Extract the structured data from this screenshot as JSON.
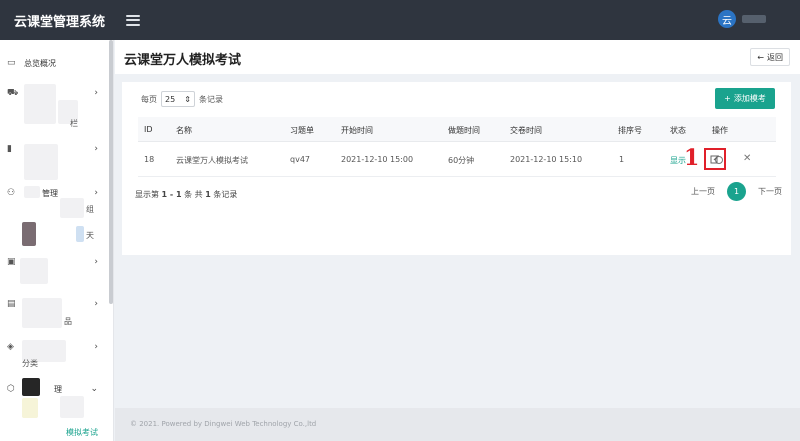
{
  "header": {
    "brand": "云课堂管理系统",
    "avatar_char": "云"
  },
  "sidebar": {
    "items": [
      {
        "label": "总览概况",
        "has_chevron": false
      },
      {
        "label": "",
        "has_chevron": true
      },
      {
        "label": "",
        "has_chevron": true
      },
      {
        "label": "管理",
        "has_chevron": true
      },
      {
        "label": "",
        "has_chevron": true
      },
      {
        "label": "",
        "has_chevron": true
      },
      {
        "label": "",
        "has_chevron": true
      },
      {
        "label": "理",
        "has_chevron": true
      }
    ],
    "sub_labels": {
      "a": "栏",
      "b": "组",
      "c": "天",
      "d": "品",
      "e": "分类"
    },
    "active_sub": "模拟考试",
    "chevron_right": "›",
    "chevron_down": "⌄"
  },
  "page": {
    "title": "云课堂万人模拟考试",
    "back_label": "返回"
  },
  "toolbar": {
    "perpage_prefix": "每页",
    "perpage_value": "25",
    "perpage_suffix": "条记录",
    "add_label": "添加模考"
  },
  "table": {
    "columns": [
      "ID",
      "名称",
      "习题单",
      "开始时间",
      "做题时间",
      "交卷时间",
      "排序号",
      "状态",
      "操作"
    ],
    "rows": [
      {
        "id": "18",
        "name": "云课堂万人模拟考试",
        "sheet": "qv47",
        "start": "2021-12-10 15:00",
        "duration": "60分钟",
        "submit": "2021-12-10 15:10",
        "order": "1",
        "status": "显示"
      }
    ]
  },
  "annotation": "1",
  "summary": {
    "prefix": "显示第",
    "range": "1 - 1",
    "mid": "条  共",
    "total": "1",
    "suffix": "条记录"
  },
  "pager": {
    "prev": "上一页",
    "current": "1",
    "next": "下一页"
  },
  "footer": {
    "text": "© 2021. Powered by Dingwei Web Technology Co.,ltd"
  },
  "colors": {
    "accent": "#1aa38e",
    "topbar": "#2f353f",
    "highlight": "#e0202a"
  }
}
